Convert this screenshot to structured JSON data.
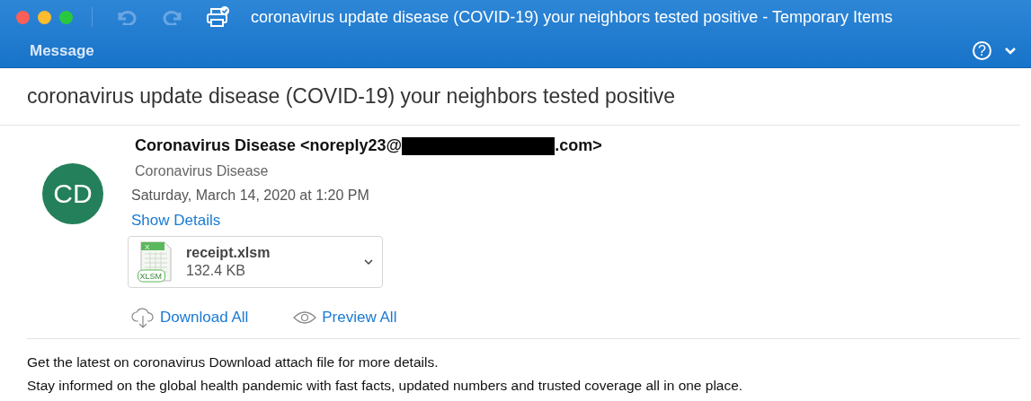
{
  "window": {
    "title": "coronavirus update disease (COVID-19) your neighbors tested positive - Temporary Items"
  },
  "ribbon": {
    "tab": "Message",
    "help": "?"
  },
  "message": {
    "subject": "coronavirus update disease (COVID-19) your neighbors tested positive",
    "avatar": "CD",
    "sender_before": "Coronavirus Disease <noreply23@",
    "sender_after": ".com>",
    "sender_name": "Coronavirus Disease",
    "date": "Saturday, March 14, 2020 at 1:20 PM",
    "show_details": "Show Details",
    "attachment": {
      "name": "receipt.xlsm",
      "size": "132.4 KB",
      "badge": "XLSM",
      "letter": "X"
    },
    "actions": [
      {
        "kind": "download",
        "label": "Download All"
      },
      {
        "kind": "preview",
        "label": "Preview All"
      }
    ],
    "body": [
      "Get the latest on coronavirus Download attach file for more details.",
      "Stay informed on the global health pandemic with fast facts, updated numbers and trusted coverage all in one place."
    ]
  }
}
